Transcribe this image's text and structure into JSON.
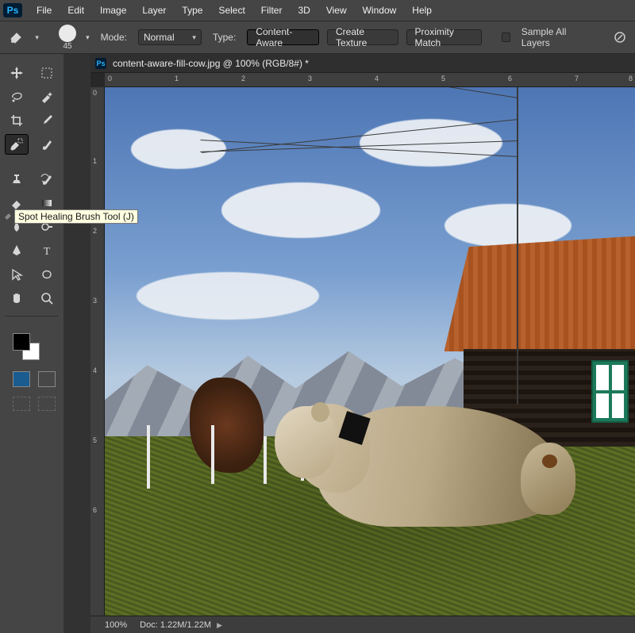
{
  "app": {
    "logo_text": "Ps"
  },
  "menu": [
    "File",
    "Edit",
    "Image",
    "Layer",
    "Type",
    "Select",
    "Filter",
    "3D",
    "View",
    "Window",
    "Help"
  ],
  "options": {
    "brush_size": "45",
    "mode_label": "Mode:",
    "mode_value": "Normal",
    "type_label": "Type:",
    "type_content_aware": "Content-Aware",
    "type_create_texture": "Create Texture",
    "type_proximity": "Proximity Match",
    "sample_all_label": "Sample All Layers"
  },
  "tooltip": {
    "text": "Spot Healing Brush Tool (J)"
  },
  "document": {
    "title": "content-aware-fill-cow.jpg @ 100% (RGB/8#) *",
    "zoom": "100%",
    "doc_size": "Doc: 1.22M/1.22M"
  },
  "ruler": {
    "top_labels": [
      "0",
      "1",
      "2",
      "3",
      "4",
      "5",
      "6",
      "7",
      "8"
    ],
    "left_labels": [
      "0",
      "1",
      "2",
      "3",
      "4",
      "5",
      "6"
    ]
  },
  "tools": {
    "row1a": "move-tool",
    "row1b": "rectangular-marquee-tool",
    "row2a": "lasso-tool",
    "row2b": "quick-selection-tool",
    "row3a": "crop-tool",
    "row3b": "eyedropper-tool",
    "row4a": "spot-healing-brush-tool",
    "row4b": "brush-tool",
    "row5a": "clone-stamp-tool",
    "row5b": "history-brush-tool",
    "row6a": "eraser-tool",
    "row6b": "gradient-tool",
    "row7a": "blur-tool",
    "row7b": "dodge-tool",
    "row8a": "pen-tool",
    "row8b": "type-tool",
    "row9a": "path-selection-tool",
    "row9b": "custom-shape-tool",
    "row10a": "hand-tool",
    "row10b": "zoom-tool"
  }
}
